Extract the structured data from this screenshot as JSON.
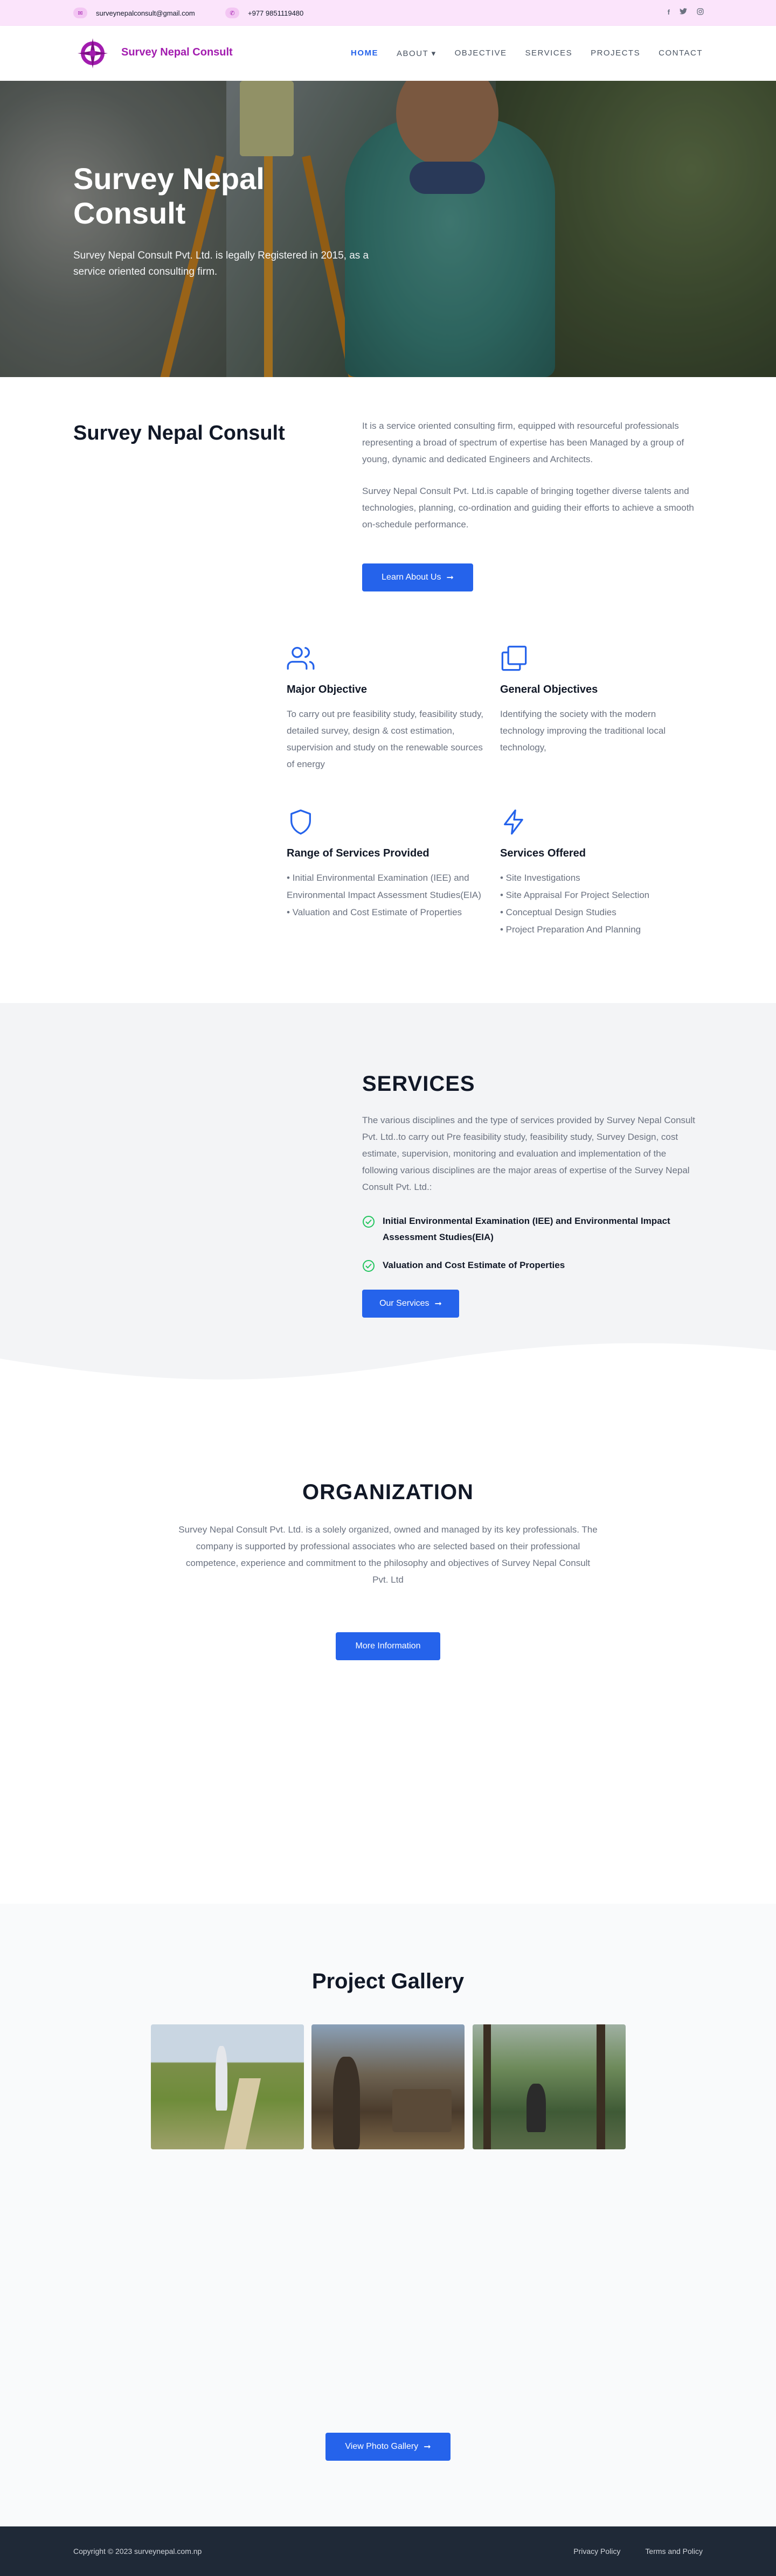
{
  "topbar": {
    "email": "surveynepalconsult@gmail.com",
    "phone": "+977 9851119480",
    "social": [
      "facebook-icon",
      "twitter-icon",
      "instagram-icon"
    ]
  },
  "nav": {
    "brand": "Survey Nepal Consult",
    "items": [
      {
        "label": "HOME",
        "active": true
      },
      {
        "label": "ABOUT ▾",
        "active": false
      },
      {
        "label": "OBJECTIVE",
        "active": false
      },
      {
        "label": "SERVICES",
        "active": false
      },
      {
        "label": "PROJECTS",
        "active": false
      },
      {
        "label": "CONTACT",
        "active": false
      }
    ]
  },
  "hero": {
    "title": "Survey Nepal Consult",
    "subtitle": "Survey Nepal Consult Pvt. Ltd. is legally Registered in 2015, as a service oriented consulting firm."
  },
  "about": {
    "title": "Survey Nepal Consult",
    "para1": "It is a service oriented consulting firm, equipped with resourceful professionals representing a broad of spectrum of expertise has been Managed by a group of young, dynamic and dedicated Engineers and Architects.",
    "para2": "Survey Nepal Consult Pvt. Ltd.is capable of bringing together diverse talents and technologies, planning, co-ordination and guiding their efforts to achieve a smooth on-schedule performance.",
    "button": "Learn About Us"
  },
  "features": {
    "major": {
      "icon": "users-icon",
      "title": "Major Objective",
      "text": "To carry out pre feasibility study, feasibility study, detailed survey, design & cost estimation, supervision and study on the renewable sources of energy"
    },
    "general": {
      "icon": "copy-icon",
      "title": "General Objectives",
      "text": "Identifying the society with the modern technology improving the traditional local technology,"
    },
    "range": {
      "icon": "shield-icon",
      "title": "Range of Services Provided",
      "items": [
        "• Initial Environmental Examination (IEE) and Environmental Impact Assessment Studies(EIA)",
        "• Valuation and Cost Estimate of Properties"
      ]
    },
    "offered": {
      "icon": "zap-icon",
      "title": "Services Offered",
      "items": [
        "• Site Investigations",
        "• Site Appraisal For Project Selection",
        "• Conceptual Design Studies",
        "• Project Preparation And Planning"
      ]
    }
  },
  "services": {
    "title": "SERVICES",
    "text": "The various disciplines and the type of services provided by Survey Nepal Consult Pvt. Ltd..to carry out Pre feasibility study, feasibility study, Survey Design, cost estimate, supervision, monitoring and evaluation and implementation of the following various disciplines are the major areas of expertise of the Survey Nepal Consult Pvt. Ltd.:",
    "items": [
      "Initial Environmental Examination (IEE) and Environmental Impact Assessment Studies(EIA)",
      "Valuation and Cost Estimate of Properties"
    ],
    "button": "Our Services"
  },
  "organization": {
    "title": "ORGANIZATION",
    "text": "Survey Nepal Consult Pvt. Ltd. is a solely organized, owned and managed by its key professionals. The company is supported by professional associates who are selected based on their professional competence, experience and commitment to the philosophy and objectives of Survey Nepal Consult Pvt. Ltd",
    "button": "More Information"
  },
  "gallery": {
    "title": "Project Gallery",
    "button": "View Photo Gallery"
  },
  "footer": {
    "copyright": "Copyright © 2023 surveynepal.com.np",
    "links": [
      "Privacy Policy",
      "Terms and Policy"
    ]
  },
  "colors": {
    "accent": "#2563eb",
    "brand": "#a21caf",
    "topbar": "#fbe4fb",
    "footer": "#1f2937"
  }
}
